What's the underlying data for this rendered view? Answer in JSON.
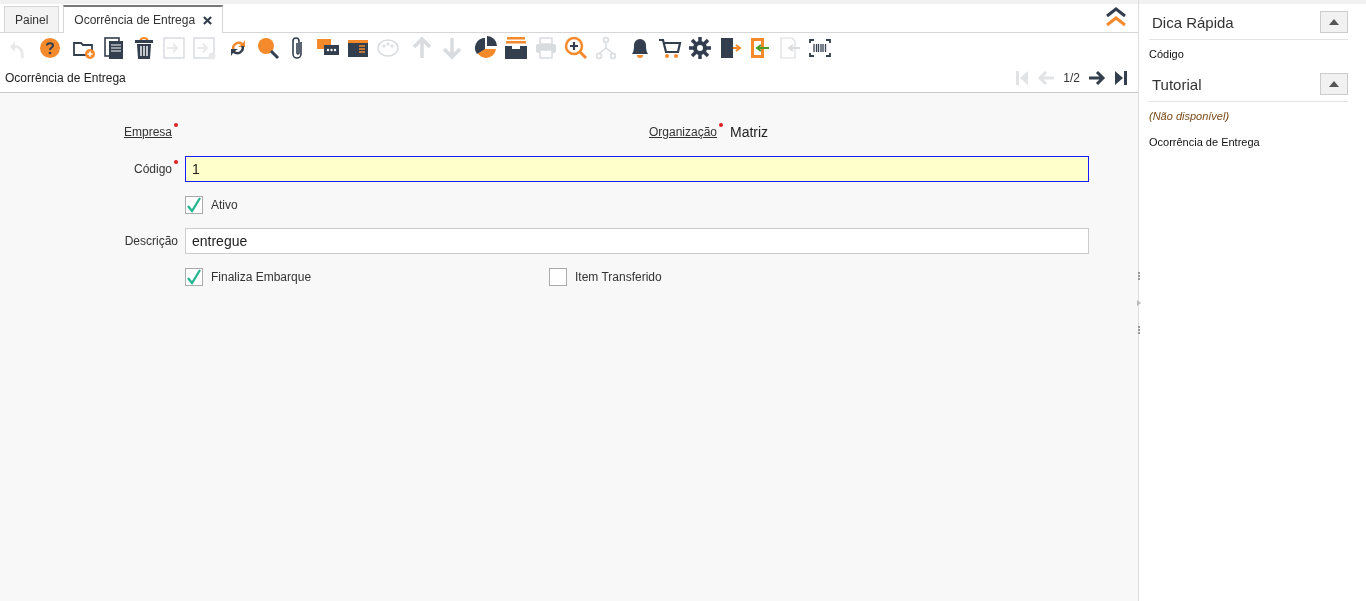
{
  "tabs": [
    {
      "label": "Painel",
      "selected": false,
      "closable": false
    },
    {
      "label": "Ocorrência de Entrega",
      "selected": true,
      "closable": true
    }
  ],
  "toolbar": {
    "groups": [
      [
        {
          "kind": "undo",
          "disabled": true
        },
        {
          "kind": "help",
          "disabled": false
        }
      ],
      [
        {
          "kind": "new",
          "disabled": false
        },
        {
          "kind": "copy",
          "disabled": false
        },
        {
          "kind": "delete",
          "disabled": false
        },
        {
          "kind": "save",
          "disabled": true
        },
        {
          "kind": "save-new",
          "disabled": true
        }
      ],
      [
        {
          "kind": "refresh",
          "disabled": false
        },
        {
          "kind": "search",
          "disabled": false
        },
        {
          "kind": "attach",
          "disabled": false
        },
        {
          "kind": "chat",
          "disabled": false
        },
        {
          "kind": "report",
          "disabled": false
        },
        {
          "kind": "palette",
          "disabled": true
        }
      ],
      [
        {
          "kind": "up",
          "disabled": true
        },
        {
          "kind": "down",
          "disabled": true
        }
      ],
      [
        {
          "kind": "chart",
          "disabled": false
        },
        {
          "kind": "archive",
          "disabled": false
        },
        {
          "kind": "print",
          "disabled": true
        },
        {
          "kind": "zoom",
          "disabled": false
        },
        {
          "kind": "workflow",
          "disabled": true
        }
      ],
      [
        {
          "kind": "bell",
          "disabled": false
        },
        {
          "kind": "cart",
          "disabled": false
        },
        {
          "kind": "gear",
          "disabled": false
        },
        {
          "kind": "exit",
          "disabled": false
        },
        {
          "kind": "enter",
          "disabled": false
        },
        {
          "kind": "paste",
          "disabled": true
        },
        {
          "kind": "barcode",
          "disabled": false
        }
      ]
    ]
  },
  "record_title": "Ocorrência de Entrega",
  "navigation": {
    "first_disabled": true,
    "previous_disabled": true,
    "position": "1/2",
    "next_disabled": false,
    "last_disabled": false
  },
  "form": {
    "empresa": {
      "label": "Empresa",
      "required": true,
      "link": true
    },
    "organizacao": {
      "label": "Organização",
      "required": true,
      "link": true,
      "value": "Matriz"
    },
    "codigo": {
      "label": "Código",
      "required": true,
      "value": "1",
      "focused": true
    },
    "ativo": {
      "label": "Ativo",
      "checked": true
    },
    "descricao": {
      "label": "Descrição",
      "value": "entregue",
      "focused": false
    },
    "finaliza_embarque": {
      "label": "Finaliza Embarque",
      "checked": true
    },
    "item_transferido": {
      "label": "Item Transferido",
      "checked": false
    }
  },
  "side_panel": [
    {
      "title": "Dica Rápida",
      "expanded": true,
      "items": [
        {
          "text": "Código",
          "italic": false
        }
      ]
    },
    {
      "title": "Tutorial",
      "expanded": true,
      "items": [
        {
          "text": "(Não disponível)",
          "italic": true
        },
        {
          "text": "Ocorrência de Entrega",
          "italic": false
        }
      ]
    }
  ]
}
